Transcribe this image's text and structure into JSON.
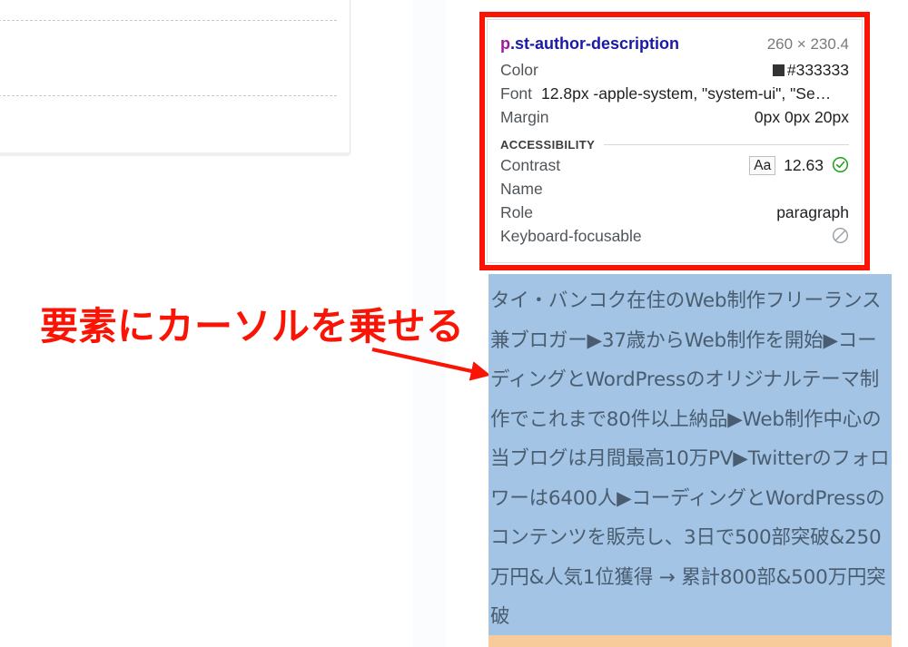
{
  "annotation": {
    "text": "要素にカーソルを乗せる",
    "color": "#fa1405",
    "arrow_icon": "arrow-pointing-down-right"
  },
  "inspector_tooltip": {
    "border_color": "#fa1405",
    "selector": {
      "tag": "p",
      "class": ".st-author-description",
      "dimensions": "260 × 230.4"
    },
    "properties": [
      {
        "label": "Color",
        "value": "#333333",
        "swatch": "#333333"
      },
      {
        "label": "Font",
        "value": "12.8px -apple-system, \"system-ui\", \"Se…"
      },
      {
        "label": "Margin",
        "value": "0px 0px 20px"
      }
    ],
    "accessibility": {
      "section_title": "ACCESSIBILITY",
      "contrast": {
        "label": "Contrast",
        "badge": "Aa",
        "value": "12.63",
        "status_icon": "check-circle-icon",
        "status_color": "#1aa019"
      },
      "name": {
        "label": "Name",
        "value": ""
      },
      "role": {
        "label": "Role",
        "value": "paragraph"
      },
      "keyboard_focusable": {
        "label": "Keyboard-focusable",
        "status_icon": "blocked-circle-icon"
      }
    }
  },
  "element_highlight": {
    "content_color": "#a3c4e5",
    "margin_color": "#f8cb9b",
    "text": "タイ・バンコク在住のWeb制作フリーランス兼ブロガー▶37歳からWeb制作を開始▶コーディングとWordPressのオリジナルテーマ制作でこれまで80件以上納品▶Web制作中心の当ブログは月間最高10万PV▶Twitterのフォロワーは6400人▶コーディングとWordPressのコンテンツを販売し、3日で500部突破&250万円&人気1位獲得 → 累計800部&500万円突破"
  }
}
